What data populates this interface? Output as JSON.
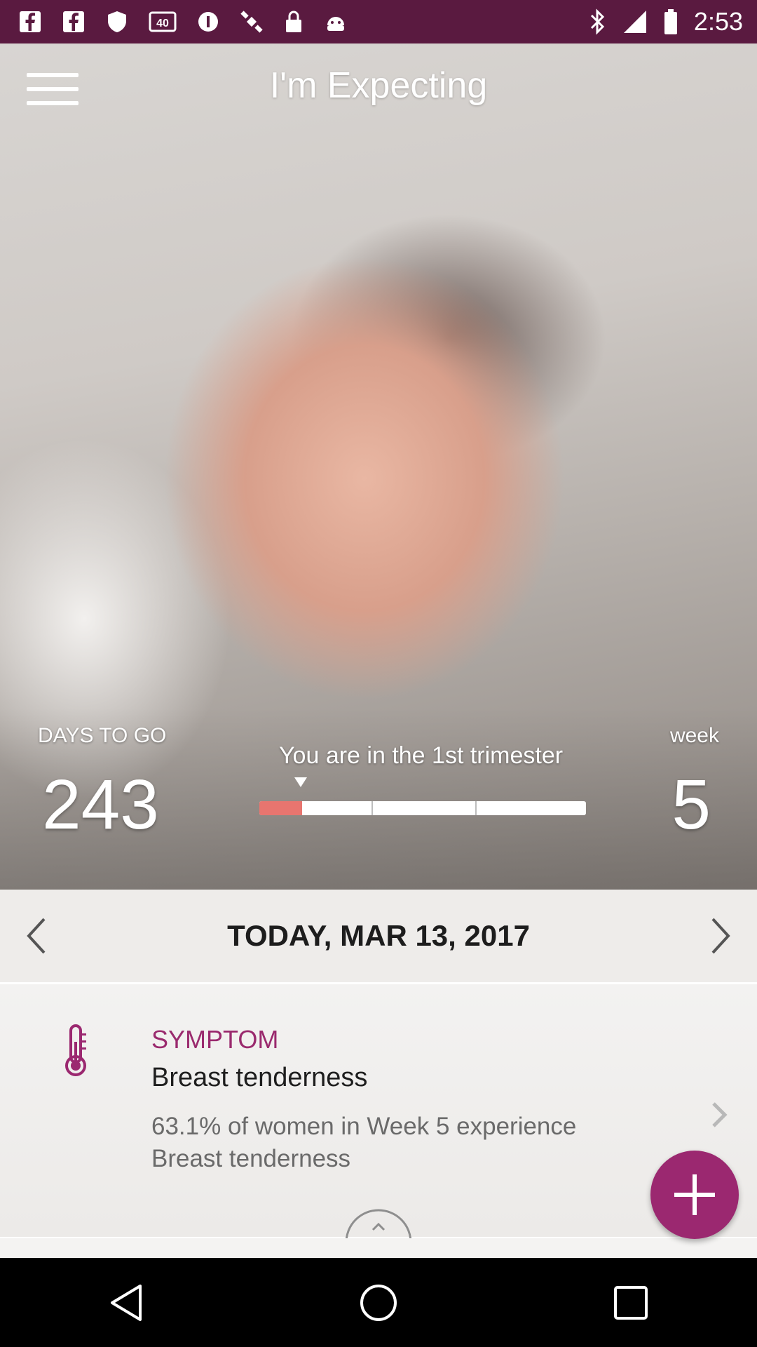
{
  "status_bar": {
    "time": "2:53",
    "left_icons": [
      "facebook-icon",
      "facebook-icon",
      "shield-icon",
      "lte-icon",
      "info-icon",
      "satellite-icon",
      "lock-icon",
      "android-icon"
    ],
    "right_icons": [
      "bluetooth-icon",
      "signal-icon",
      "battery-icon"
    ]
  },
  "header": {
    "title": "I'm Expecting",
    "menu_icon": "hamburger-menu-icon"
  },
  "stats": {
    "days_label": "DAYS TO GO",
    "days_value": "243",
    "week_label": "week",
    "week_value": "5",
    "trimester_text": "You are in the 1st trimester",
    "progress": 0.13
  },
  "date_nav": {
    "date_text": "TODAY, MAR 13, 2017",
    "prev_icon": "chevron-left-icon",
    "next_icon": "chevron-right-icon"
  },
  "symptom_card": {
    "heading": "SYMPTOM",
    "name": "Breast tenderness",
    "description": "63.1% of women in Week 5 experience Breast tenderness",
    "icon": "thermometer-icon"
  },
  "colors": {
    "accent": "#9b2870",
    "status_bar": "#5a1a40",
    "progress_fill": "#e8756f"
  }
}
